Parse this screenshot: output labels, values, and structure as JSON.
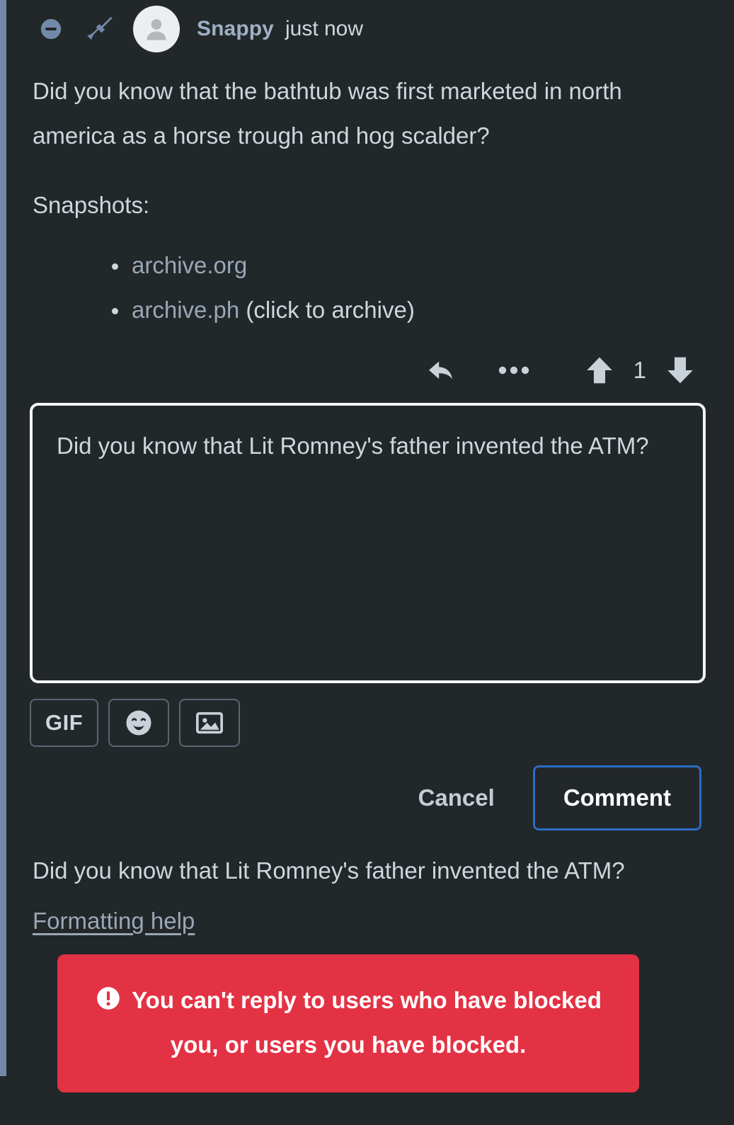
{
  "comment": {
    "header": {
      "collapse_icon": "minus-circle-icon",
      "mod_icon": "broom-icon",
      "avatar_icon": "user-avatar-icon",
      "username": "Snappy",
      "timestamp": "just now"
    },
    "paragraphs": [
      "Did you know that the bathtub was first marketed in north america as a horse trough and hog scalder?",
      "Snapshots:"
    ],
    "snapshots": [
      {
        "link": "archive.org",
        "suffix": ""
      },
      {
        "link": "archive.ph",
        "suffix": " (click to archive)"
      }
    ],
    "actions": {
      "reply_icon": "reply-arrow-icon",
      "more_icon": "ellipsis-icon",
      "upvote_icon": "arrow-up-icon",
      "vote_count": "1",
      "downvote_icon": "arrow-down-icon"
    }
  },
  "composer": {
    "reply_value": "Did you know that Lit Romney's father invented the ATM?",
    "reply_placeholder": "",
    "media": {
      "gif_label": "GIF",
      "emoji_icon": "smiley-face-icon",
      "image_icon": "image-picture-icon"
    },
    "cancel_label": "Cancel",
    "submit_label": "Comment"
  },
  "preview": {
    "text": "Did you know that Lit Romney's father invented the ATM?",
    "formatting_help_label": "Formatting help"
  },
  "toast": {
    "icon": "exclamation-circle-icon",
    "message": "You can't reply to users who have blocked you, or users you have blocked.",
    "background_color": "#e33244",
    "text_color": "#ffffff"
  },
  "theme": {
    "background": "#22272a",
    "text": "#cfd6dc",
    "thread_line": "#7389a8",
    "link": "#9aa7b5",
    "username": "#9fb0c6",
    "accent_blue": "#2b6cc4",
    "error_red": "#e33244"
  }
}
